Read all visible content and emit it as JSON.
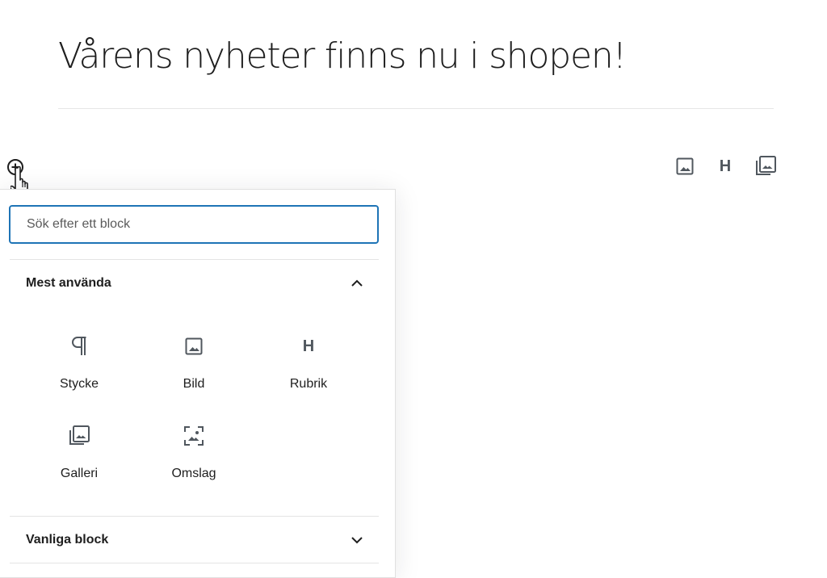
{
  "post": {
    "title": "Vårens nyheter finns nu i shopen!"
  },
  "toolbar": {
    "quick_blocks": [
      {
        "name": "image-icon"
      },
      {
        "name": "heading-icon",
        "glyph": "H"
      },
      {
        "name": "gallery-icon"
      }
    ]
  },
  "inserter": {
    "search_placeholder": "Sök efter ett block",
    "sections": [
      {
        "title": "Mest använda",
        "expanded": true,
        "blocks": [
          {
            "label": "Stycke",
            "icon": "paragraph-icon"
          },
          {
            "label": "Bild",
            "icon": "image-icon"
          },
          {
            "label": "Rubrik",
            "icon": "heading-icon",
            "glyph": "H"
          },
          {
            "label": "Galleri",
            "icon": "gallery-icon"
          },
          {
            "label": "Omslag",
            "icon": "cover-icon"
          }
        ]
      },
      {
        "title": "Vanliga block",
        "expanded": false
      }
    ]
  },
  "colors": {
    "accent": "#1e74b6",
    "icon": "#50575e",
    "text": "#1e1e1e"
  }
}
